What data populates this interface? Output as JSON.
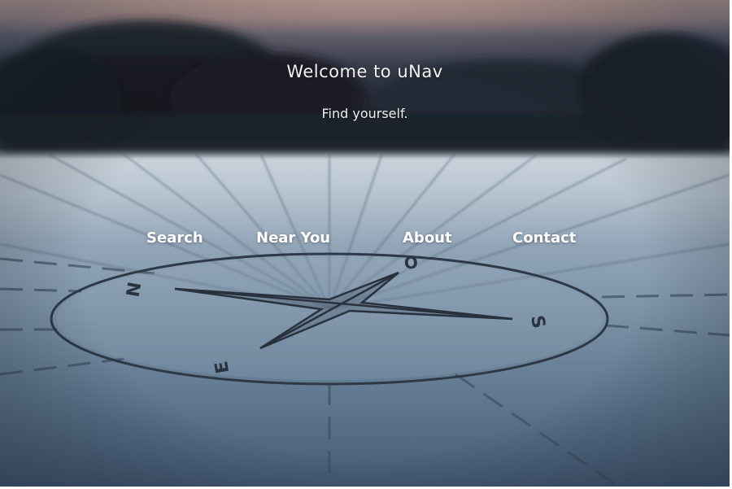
{
  "hero": {
    "title": "Welcome to uNav",
    "subtitle": "Find yourself."
  },
  "nav": {
    "items": [
      {
        "label": "Search"
      },
      {
        "label": "Near You"
      },
      {
        "label": "About"
      },
      {
        "label": "Contact"
      }
    ]
  },
  "compass": {
    "letters": [
      "N",
      "O",
      "S",
      "E"
    ]
  },
  "colors": {
    "sky_top": "#d9b4a8",
    "treeline": "#1d212b",
    "table_light": "#c9d2da",
    "table_dark": "#445a74",
    "text": "#ffffff"
  }
}
